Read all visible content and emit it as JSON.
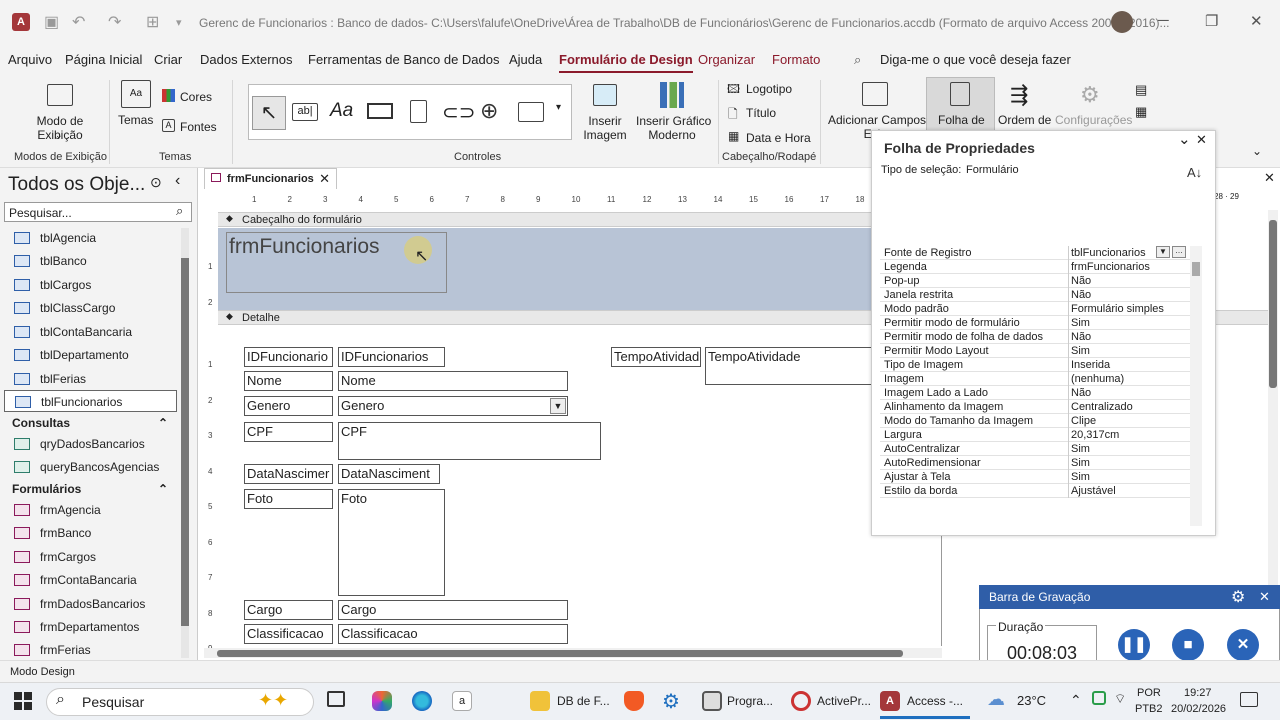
{
  "window": {
    "title": "Gerenc de Funcionarios : Banco de dados- C:\\Users\\falufe\\OneDrive\\Área de Trabalho\\DB de Funcionários\\Gerenc de Funcionarios.accdb (Formato de arquivo Access 2007 - 2016)...",
    "app_icon": "A"
  },
  "menu": {
    "items": [
      "Arquivo",
      "Página Inicial",
      "Criar",
      "Dados Externos",
      "Ferramentas de Banco de Dados",
      "Ajuda",
      "Formulário de Design",
      "Organizar",
      "Formato"
    ],
    "tell_me": "Diga-me o que você deseja fazer"
  },
  "ribbon": {
    "modo_exibicao": "Modo de\nExibição",
    "temas": "Temas",
    "cores": "Cores",
    "fontes": "Fontes",
    "inserir_imagem": "Inserir\nImagem",
    "inserir_grafico": "Inserir Gráfico\nModerno",
    "logotipo": "Logotipo",
    "titulo": "Título",
    "data_hora": "Data e Hora",
    "adicionar_campos": "Adicionar Campos\nExis",
    "folha_de": "Folha de",
    "ordem_de": "Ordem de",
    "configuracoes": "Configurações",
    "groups": [
      "Modos de Exibição",
      "Temas",
      "Controles",
      "Cabeçalho/Rodapé"
    ]
  },
  "nav": {
    "title": "Todos os Obje...",
    "search_placeholder": "Pesquisar...",
    "tables": [
      "tblAgencia",
      "tblBanco",
      "tblCargos",
      "tblClassCargo",
      "tblContaBancaria",
      "tblDepartamento",
      "tblFerias",
      "tblFuncionarios"
    ],
    "consultas_header": "Consultas",
    "consultas": [
      "qryDadosBancarios",
      "queryBancosAgencias"
    ],
    "formularios_header": "Formulários",
    "formularios": [
      "frmAgencia",
      "frmBanco",
      "frmCargos",
      "frmContaBancaria",
      "frmDadosBancarios",
      "frmDepartamentos",
      "frmFerias"
    ]
  },
  "document": {
    "tab_label": "frmFuncionarios",
    "ruler_numbers": [
      "1",
      "2",
      "3",
      "4",
      "5",
      "6",
      "7",
      "8",
      "9",
      "10",
      "11",
      "12",
      "13",
      "14",
      "15",
      "16",
      "17",
      "18"
    ],
    "ruler_right": [
      "28",
      "29"
    ],
    "vruler_header": [
      "1",
      "2"
    ],
    "vruler_detail": [
      "1",
      "2",
      "3",
      "4",
      "5",
      "6",
      "7",
      "8",
      "9"
    ],
    "header_section": "Cabeçalho do formulário",
    "header_title": "frmFuncionarios",
    "detail_section": "Detalhe",
    "fields": [
      {
        "label": "IDFuncionario",
        "control": "IDFuncionarios"
      },
      {
        "label": "Nome",
        "control": "Nome"
      },
      {
        "label": "Genero",
        "control": "Genero"
      },
      {
        "label": "CPF",
        "control": "CPF"
      },
      {
        "label": "DataNascimer",
        "control": "DataNasciment"
      },
      {
        "label": "Foto",
        "control": "Foto"
      },
      {
        "label": "Cargo",
        "control": "Cargo"
      },
      {
        "label": "Classificacao",
        "control": "Classificacao"
      }
    ],
    "tempo_label": "TempoAtividad",
    "tempo_control": "TempoAtividade"
  },
  "properties": {
    "title": "Folha de Propriedades",
    "selection_type_label": "Tipo de seleção:",
    "selection_type_value": "Formulário",
    "rows": [
      {
        "name": "Fonte de Registro",
        "value": "tblFuncionarios"
      },
      {
        "name": "Legenda",
        "value": "frmFuncionarios"
      },
      {
        "name": "Pop-up",
        "value": "Não"
      },
      {
        "name": "Janela restrita",
        "value": "Não"
      },
      {
        "name": "Modo padrão",
        "value": "Formulário simples"
      },
      {
        "name": "Permitir modo de formulário",
        "value": "Sim"
      },
      {
        "name": "Permitir modo de folha de dados",
        "value": "Não"
      },
      {
        "name": "Permitir Modo Layout",
        "value": "Sim"
      },
      {
        "name": "Tipo de Imagem",
        "value": "Inserida"
      },
      {
        "name": "Imagem",
        "value": "(nenhuma)"
      },
      {
        "name": "Imagem Lado a Lado",
        "value": "Não"
      },
      {
        "name": "Alinhamento da Imagem",
        "value": "Centralizado"
      },
      {
        "name": "Modo do Tamanho da Imagem",
        "value": "Clipe"
      },
      {
        "name": "Largura",
        "value": "20,317cm"
      },
      {
        "name": "AutoCentralizar",
        "value": "Sim"
      },
      {
        "name": "AutoRedimensionar",
        "value": "Sim"
      },
      {
        "name": "Ajustar à Tela",
        "value": "Sim"
      },
      {
        "name": "Estilo da borda",
        "value": "Ajustável"
      }
    ]
  },
  "recorder": {
    "title": "Barra de Gravação",
    "duration_label": "Duração",
    "duration": "00:08:03"
  },
  "status": {
    "text": "Modo Design"
  },
  "taskbar": {
    "search": "Pesquisar",
    "apps": [
      "DB de F...",
      "Progra...",
      "ActivePr...",
      "Access -..."
    ],
    "temperature": "23°C",
    "lang1": "POR",
    "lang2": "PTB2",
    "time": "19:27",
    "date": "20/02/2026"
  },
  "colors": {
    "accent": "#8b1a2b",
    "recorder": "#2f5ea8",
    "header_section": "#b8c4d6"
  }
}
